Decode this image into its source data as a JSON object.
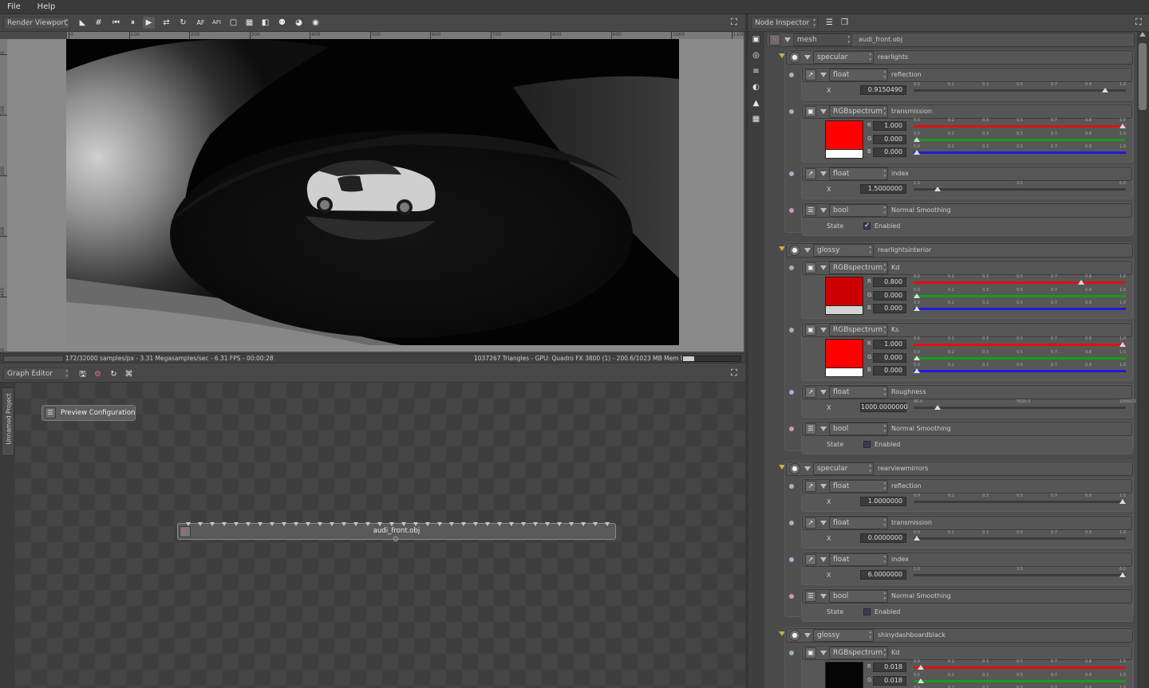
{
  "menu": [
    "File",
    "Help"
  ],
  "viewport": {
    "selector": "Render Viewport",
    "ruler_x": [
      "0",
      "100",
      "200",
      "300",
      "400",
      "500",
      "600",
      "700",
      "800",
      "900",
      "1000",
      "1100"
    ],
    "ruler_y": [
      "0",
      "100",
      "200",
      "300",
      "400",
      "500"
    ],
    "status_left": "172/32000 samples/px - 3.31 Megasamples/sec - 6.31 FPS - 00:00:28",
    "status_right": "1037267 Triangles - GPU: Quadro FX 3800 (1) - 200.6/1023 MB Mem Used",
    "toolbar_icons": [
      "select-icon",
      "crop-icon",
      "skip-back-icon",
      "pause-icon",
      "play-icon",
      "export-icon",
      "refresh-icon",
      "af-icon",
      "afi-icon",
      "frame-icon",
      "checker-icon",
      "region-icon",
      "glasses-icon",
      "sphere-icon",
      "camera-icon"
    ],
    "toolbar_text": {
      "af": "AF",
      "afi": "AFI"
    }
  },
  "graph_editor": {
    "selector": "Graph Editor",
    "tab": "Unnamed Project",
    "preview_node": "Preview Configuration",
    "mesh_node": "audi_front.obj"
  },
  "inspector": {
    "selector": "Node Inspector",
    "root": {
      "type": "mesh",
      "name": "audi_front.obj"
    },
    "labels": {
      "x": "X",
      "r": "R",
      "g": "G",
      "b": "B",
      "state": "State",
      "enabled": "Enabled"
    },
    "materials": [
      {
        "type": "specular",
        "name": "rearlights",
        "params": [
          {
            "type": "float",
            "name": "reflection",
            "value": "0.9150490",
            "ticks": [
              "0.0",
              "0.2",
              "0.3",
              "0.5",
              "0.7",
              "0.8",
              "1.0"
            ],
            "pos": 0.915
          },
          {
            "type": "RGBspectrum",
            "name": "transmission",
            "r": "1.000",
            "g": "0.000",
            "b": "0.000",
            "r_pos": 1.0,
            "g_pos": 0.0,
            "b_pos": 0.0,
            "top": "#ff0000",
            "bottom": "#ffffff",
            "ticks": [
              "0.0",
              "0.2",
              "0.3",
              "0.5",
              "0.7",
              "0.8",
              "1.0"
            ]
          },
          {
            "type": "float",
            "name": "index",
            "value": "1.5000000",
            "ticks": [
              "1.0",
              "",
              "",
              "3.5",
              "",
              "",
              "6.0"
            ],
            "pos": 0.1
          },
          {
            "type": "bool",
            "name": "Normal Smoothing",
            "checked": true
          }
        ]
      },
      {
        "type": "glossy",
        "name": "rearlightsinterior",
        "params": [
          {
            "type": "RGBspectrum",
            "name": "Kd",
            "r": "0.800",
            "g": "0.000",
            "b": "0.000",
            "r_pos": 0.8,
            "g_pos": 0.0,
            "b_pos": 0.0,
            "top": "#cc0000",
            "bottom": "#d4d4d4",
            "ticks": [
              "0.0",
              "0.2",
              "0.3",
              "0.5",
              "0.7",
              "0.8",
              "1.0"
            ]
          },
          {
            "type": "RGBspectrum",
            "name": "Ks",
            "r": "1.000",
            "g": "0.000",
            "b": "0.000",
            "r_pos": 1.0,
            "g_pos": 0.0,
            "b_pos": 0.0,
            "top": "#ff0000",
            "bottom": "#ffffff",
            "ticks": [
              "0.0",
              "0.2",
              "0.3",
              "0.5",
              "0.7",
              "0.8",
              "1.0"
            ]
          },
          {
            "type": "float",
            "name": "Roughness",
            "value": "1000.0000000",
            "ticks": [
              "40.0",
              "",
              "",
              "5020.0",
              "",
              "",
              "10000.0"
            ],
            "pos": 0.1
          },
          {
            "type": "bool",
            "name": "Normal Smoothing",
            "checked": false
          }
        ]
      },
      {
        "type": "specular",
        "name": "rearviewmirrors",
        "params": [
          {
            "type": "float",
            "name": "reflection",
            "value": "1.0000000",
            "ticks": [
              "0.0",
              "0.2",
              "0.3",
              "0.5",
              "0.7",
              "0.8",
              "1.0"
            ],
            "pos": 1.0
          },
          {
            "type": "float",
            "name": "transmission",
            "value": "0.0000000",
            "ticks": [
              "0.0",
              "0.2",
              "0.3",
              "0.5",
              "0.7",
              "0.8",
              "1.0"
            ],
            "pos": 0.0
          },
          {
            "type": "float",
            "name": "index",
            "value": "6.0000000",
            "ticks": [
              "1.0",
              "",
              "",
              "3.5",
              "",
              "",
              "6.0"
            ],
            "pos": 1.0
          },
          {
            "type": "bool",
            "name": "Normal Smoothing",
            "checked": false
          }
        ]
      },
      {
        "type": "glossy",
        "name": "shinydashboardblack",
        "params": [
          {
            "type": "RGBspectrum",
            "name": "Kd",
            "r": "0.018",
            "g": "0.018",
            "b": "",
            "r_pos": 0.018,
            "g_pos": 0.018,
            "b_pos": 0.018,
            "top": "#050505",
            "bottom": "#050505",
            "ticks": [
              "0.0",
              "0.2",
              "0.3",
              "0.5",
              "0.7",
              "0.8",
              "1.0"
            ]
          }
        ]
      }
    ]
  },
  "colors": {
    "panel": "#474747",
    "render_bg": "#8a8a8a",
    "checker_dark": "#3e3e3e",
    "checker_light": "#454545",
    "slider_r": "#e01010",
    "slider_g": "#1a9a1a",
    "slider_b": "#1a1ae0"
  }
}
